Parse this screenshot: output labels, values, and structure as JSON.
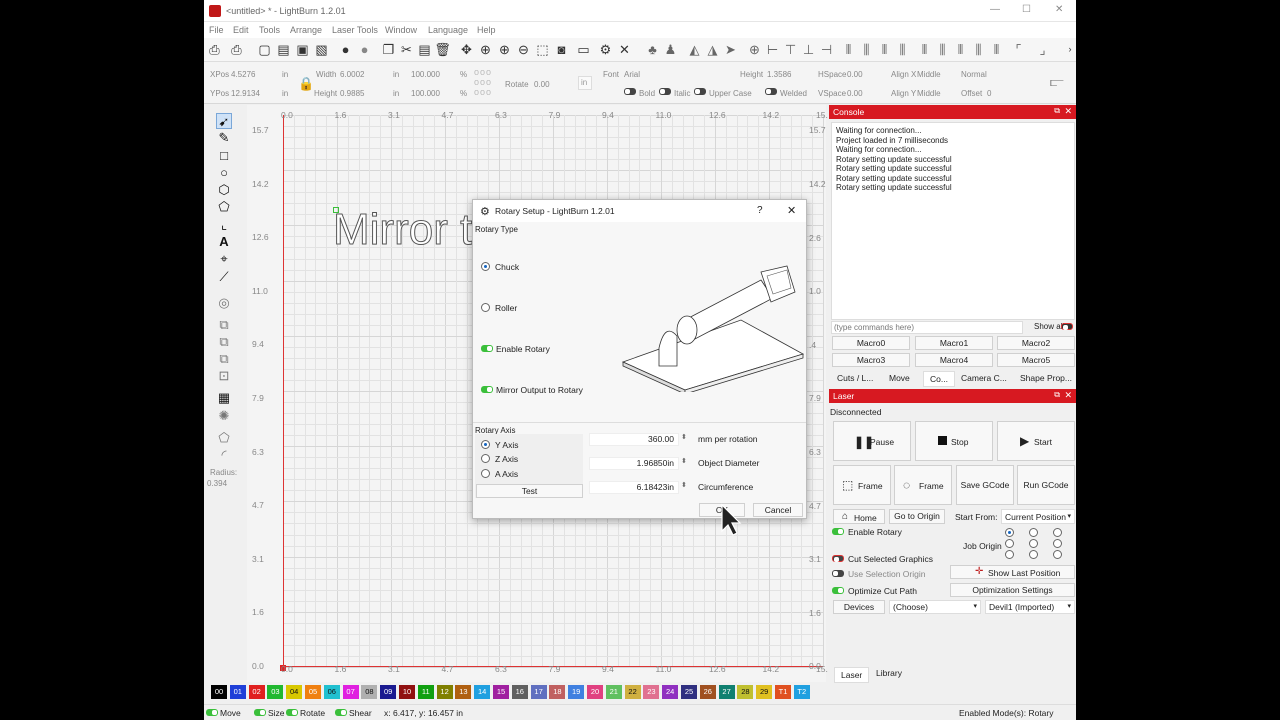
{
  "window": {
    "title": "<untitled> * - LightBurn 1.2.01",
    "controls": {
      "minimize": "—",
      "maximize": "☐",
      "close": "✕"
    }
  },
  "menu": [
    "File",
    "Edit",
    "Tools",
    "Arrange",
    "Laser Tools",
    "Window",
    "Language",
    "Help"
  ],
  "props": {
    "xpos_label": "XPos",
    "xpos": "4.5276",
    "ypos_label": "YPos",
    "ypos": "12.9134",
    "unit": "in",
    "width_label": "Width",
    "width": "6.0002",
    "height_label": "Height",
    "height": "0.9885",
    "scale_w": "100.000",
    "scale_h": "100.000",
    "pct": "%",
    "rotate_label": "Rotate",
    "rotate": "0.00",
    "rotate_unit": "in",
    "font_label": "Font",
    "font": "Arial",
    "fheight_label": "Height",
    "fheight": "1.3586",
    "hspace_label": "HSpace",
    "hspace": "0.00",
    "alignx_label": "Align X",
    "alignx": "Middle",
    "style": "Normal",
    "bold": "Bold",
    "italic": "Italic",
    "upper": "Upper Case",
    "welded": "Welded",
    "vspace_label": "VSpace",
    "vspace": "0.00",
    "aligny_label": "Align Y",
    "aligny": "Middle",
    "offset_label": "Offset",
    "offset": "0"
  },
  "left_tools": {
    "radius_label": "Radius:",
    "radius": "0.394"
  },
  "canvas": {
    "top_ticks": [
      "0.0",
      "1.6",
      "3.1",
      "4.7",
      "6.3",
      "7.9",
      "9.4",
      "11.0",
      "12.6",
      "14.2",
      "15."
    ],
    "bottom_ticks": [
      "0.0",
      "1.6",
      "3.1",
      "4.7",
      "6.3",
      "7.9",
      "9.4",
      "11.0",
      "12.6",
      "14.2",
      "15."
    ],
    "left_ticks": [
      "15.7",
      "14.2",
      "12.6",
      "11.0",
      "9.4",
      "7.9",
      "6.3",
      "4.7",
      "3.1",
      "1.6",
      "0.0"
    ],
    "right_ticks": [
      "15.7",
      "14.2",
      "2.6",
      "1.0",
      ".4",
      "7.9",
      "6.3",
      "4.7",
      "3.1",
      "1.6",
      "0.0"
    ],
    "text": "Mirror t"
  },
  "dialog": {
    "title": "Rotary Setup - LightBurn 1.2.01",
    "help": "?",
    "close": "✕",
    "rotary_type_label": "Rotary Type",
    "chuck": "Chuck",
    "roller": "Roller",
    "enable_rotary": "Enable Rotary",
    "mirror_output": "Mirror Output to Rotary",
    "rotary_axis_label": "Rotary Axis",
    "y_axis": "Y Axis",
    "z_axis": "Z Axis",
    "a_axis": "A Axis",
    "test": "Test",
    "mm_per_rotation": "360.00",
    "mm_per_rotation_label": "mm per rotation",
    "object_diameter": "1.96850in",
    "object_diameter_label": "Object Diameter",
    "circumference": "6.18423in",
    "circumference_label": "Circumference",
    "ok": "OK",
    "cancel": "Cancel"
  },
  "console": {
    "title": "Console",
    "lines": [
      "Waiting for connection...",
      "Project loaded in 7 milliseconds",
      "Waiting for connection...",
      "Rotary setting update successful",
      "Rotary setting update successful",
      "Rotary setting update successful",
      "Rotary setting update successful"
    ],
    "input_placeholder": "(type commands here)",
    "show_all": "Show all",
    "macros": [
      "Macro0",
      "Macro1",
      "Macro2",
      "Macro3",
      "Macro4",
      "Macro5"
    ],
    "tabs": [
      "Cuts / L...",
      "Move",
      "Co...",
      "Camera C...",
      "Shape Prop..."
    ]
  },
  "laser": {
    "title": "Laser",
    "status": "Disconnected",
    "pause": "Pause",
    "stop": "Stop",
    "start": "Start",
    "frame1": "Frame",
    "frame2": "Frame",
    "save_gcode": "Save GCode",
    "run_gcode": "Run GCode",
    "home": "Home",
    "go_origin": "Go to Origin",
    "start_from_label": "Start From:",
    "start_from": "Current Position",
    "enable_rotary": "Enable Rotary",
    "job_origin_label": "Job Origin",
    "cut_selected": "Cut Selected Graphics",
    "use_selection_origin": "Use Selection Origin",
    "show_last_position": "Show Last Position",
    "optimize_cut_path": "Optimize Cut Path",
    "optimization_settings": "Optimization Settings",
    "devices": "Devices",
    "device_choose": "(Choose)",
    "device_selected": "Devil1 (Imported)",
    "bottom_tabs": [
      "Laser",
      "Library"
    ]
  },
  "palette": [
    {
      "label": "00",
      "color": "#000000"
    },
    {
      "label": "01",
      "color": "#1f3fd8"
    },
    {
      "label": "02",
      "color": "#e0201f"
    },
    {
      "label": "03",
      "color": "#20b830"
    },
    {
      "label": "04",
      "color": "#d8c800"
    },
    {
      "label": "05",
      "color": "#f08010"
    },
    {
      "label": "06",
      "color": "#20c0d0"
    },
    {
      "label": "07",
      "color": "#e020e0"
    },
    {
      "label": "08",
      "color": "#b0b0b0"
    },
    {
      "label": "09",
      "color": "#1a1a90"
    },
    {
      "label": "10",
      "color": "#901010"
    },
    {
      "label": "11",
      "color": "#10a010"
    },
    {
      "label": "12",
      "color": "#808000"
    },
    {
      "label": "13",
      "color": "#b06010"
    },
    {
      "label": "14",
      "color": "#20a0e0"
    },
    {
      "label": "15",
      "color": "#a020a0"
    },
    {
      "label": "16",
      "color": "#606060"
    },
    {
      "label": "17",
      "color": "#6070c0"
    },
    {
      "label": "18",
      "color": "#c06060"
    },
    {
      "label": "19",
      "color": "#4080e0"
    },
    {
      "label": "20",
      "color": "#e04080"
    },
    {
      "label": "21",
      "color": "#60c060"
    },
    {
      "label": "22",
      "color": "#d0b040"
    },
    {
      "label": "23",
      "color": "#e07090"
    },
    {
      "label": "24",
      "color": "#9030c0"
    },
    {
      "label": "25",
      "color": "#303080"
    },
    {
      "label": "26",
      "color": "#a05020"
    },
    {
      "label": "27",
      "color": "#108070"
    },
    {
      "label": "28",
      "color": "#c0c030"
    },
    {
      "label": "29",
      "color": "#e0c020"
    },
    {
      "label": "T1",
      "color": "#e05020"
    },
    {
      "label": "T2",
      "color": "#20a0e0"
    }
  ],
  "status": {
    "move": "Move",
    "size": "Size",
    "rotate": "Rotate",
    "shear": "Shear",
    "coords": "x: 6.417, y: 16.457 in",
    "modes": "Enabled Mode(s): Rotary"
  }
}
